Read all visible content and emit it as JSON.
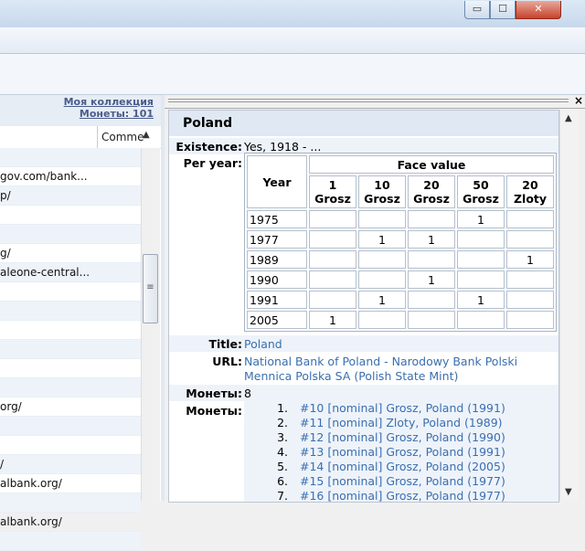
{
  "window": {
    "min_glyph": "▭",
    "max_glyph": "☐",
    "close_glyph": "✕"
  },
  "left": {
    "collection_link": "Моя коллекция",
    "coins_link": "Монеты: 101",
    "column_comment": "Comme",
    "rows": [
      "",
      "gov.com/bank...",
      "p/",
      "",
      "",
      "g/",
      "aleone-central...",
      "",
      "",
      "",
      "",
      "",
      "",
      "org/",
      "",
      "",
      "/",
      "albank.org/",
      "",
      "albank.org/",
      ""
    ]
  },
  "detail": {
    "country": "Poland",
    "existence_label": "Existence:",
    "existence_value": "Yes, 1918 - ...",
    "per_year_label": "Per year:",
    "table": {
      "year_header": "Year",
      "face_value_header": "Face value",
      "denominations": [
        {
          "value": "1",
          "unit": "Grosz"
        },
        {
          "value": "10",
          "unit": "Grosz"
        },
        {
          "value": "20",
          "unit": "Grosz"
        },
        {
          "value": "50",
          "unit": "Grosz"
        },
        {
          "value": "20",
          "unit": "Zloty"
        }
      ],
      "rows": [
        {
          "year": "1975",
          "cells": [
            "",
            "",
            "",
            "1",
            ""
          ]
        },
        {
          "year": "1977",
          "cells": [
            "",
            "1",
            "1",
            "",
            ""
          ]
        },
        {
          "year": "1989",
          "cells": [
            "",
            "",
            "",
            "",
            "1"
          ]
        },
        {
          "year": "1990",
          "cells": [
            "",
            "",
            "1",
            "",
            ""
          ]
        },
        {
          "year": "1991",
          "cells": [
            "",
            "1",
            "",
            "1",
            ""
          ]
        },
        {
          "year": "2005",
          "cells": [
            "1",
            "",
            "",
            "",
            ""
          ]
        }
      ]
    },
    "title_label": "Title:",
    "title_value": "Poland",
    "url_label": "URL:",
    "url_values": [
      "National Bank of Poland - Narodowy Bank Polski",
      "Mennica Polska SA (Polish State Mint)"
    ],
    "coins_count_label": "Монеты:",
    "coins_count_value": "8",
    "coins_label": "Монеты:",
    "coins": [
      {
        "n": "1.",
        "text": "#10 [nominal] Grosz, Poland (1991)"
      },
      {
        "n": "2.",
        "text": "#11 [nominal] Zloty, Poland (1989)"
      },
      {
        "n": "3.",
        "text": "#12 [nominal] Grosz, Poland (1990)"
      },
      {
        "n": "4.",
        "text": "#13 [nominal] Grosz, Poland (1991)"
      },
      {
        "n": "5.",
        "text": "#14 [nominal] Grosz, Poland (2005)"
      },
      {
        "n": "6.",
        "text": "#15 [nominal] Grosz, Poland (1977)"
      },
      {
        "n": "7.",
        "text": "#16 [nominal] Grosz, Poland (1977)"
      }
    ]
  }
}
